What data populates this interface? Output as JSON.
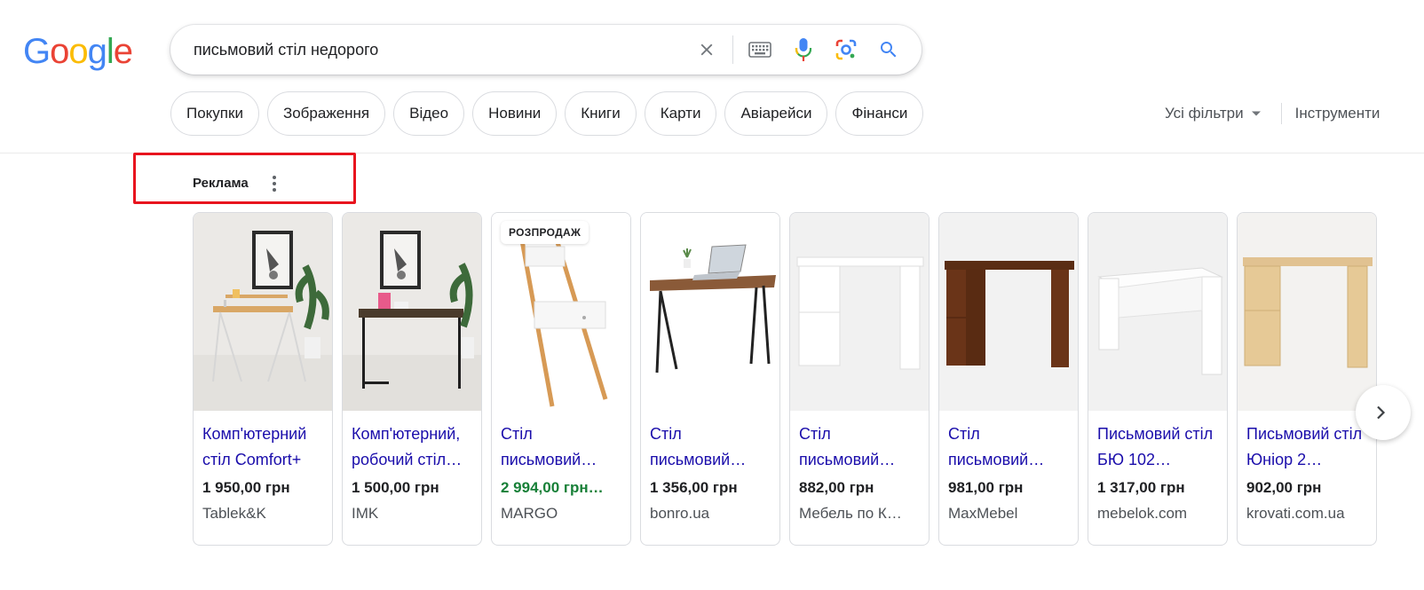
{
  "logo": {
    "letters": [
      "G",
      "o",
      "o",
      "g",
      "l",
      "e"
    ],
    "colors": [
      "#4285F4",
      "#EA4335",
      "#FBBC05",
      "#4285F4",
      "#34A853",
      "#EA4335"
    ]
  },
  "search": {
    "query": "письмовий стіл недорого"
  },
  "chips": [
    "Покупки",
    "Зображення",
    "Відео",
    "Новини",
    "Книги",
    "Карти",
    "Авіарейси",
    "Фінанси"
  ],
  "tools": {
    "all_filters": "Усі фільтри",
    "tools": "Інструменти"
  },
  "ads": {
    "label": "Реклама",
    "highlight_color": "#e8141e",
    "products": [
      {
        "title": "Комп'ютерний стіл Comfort+",
        "price": "1 950,00 грн",
        "store": "Tablek&K",
        "image": "desk-comfort-photo"
      },
      {
        "title": "Комп'ютерний, робочий стіл…",
        "price": "1 500,00 грн",
        "store": "IMK",
        "image": "desk-loft-photo"
      },
      {
        "title": "Стіл письмовий…",
        "price": "2 994,00 грн…",
        "store": "MARGO",
        "badge": "РОЗПРОДАЖ",
        "sale": true,
        "image": "ladder-desk-photo"
      },
      {
        "title": "Стіл письмовий…",
        "price": "1 356,00 грн",
        "store": "bonro.ua",
        "image": "laptop-desk-photo"
      },
      {
        "title": "Стіл письмовий…",
        "price": "882,00 грн",
        "store": "Мебель по К…",
        "image": "white-desk-photo"
      },
      {
        "title": "Стіл письмовий…",
        "price": "981,00 грн",
        "store": "MaxMebel",
        "image": "walnut-desk-photo"
      },
      {
        "title": "Письмовий стіл БЮ 102…",
        "price": "1 317,00 грн",
        "store": "mebelok.com",
        "image": "white-simple-desk-photo"
      },
      {
        "title": "Письмовий стіл Юніор 2…",
        "price": "902,00 грн",
        "store": "krovati.com.ua",
        "image": "oak-desk-photo"
      }
    ]
  },
  "colors": {
    "link": "#1a0dab",
    "sale_price": "#188038",
    "border": "#dadce0"
  }
}
